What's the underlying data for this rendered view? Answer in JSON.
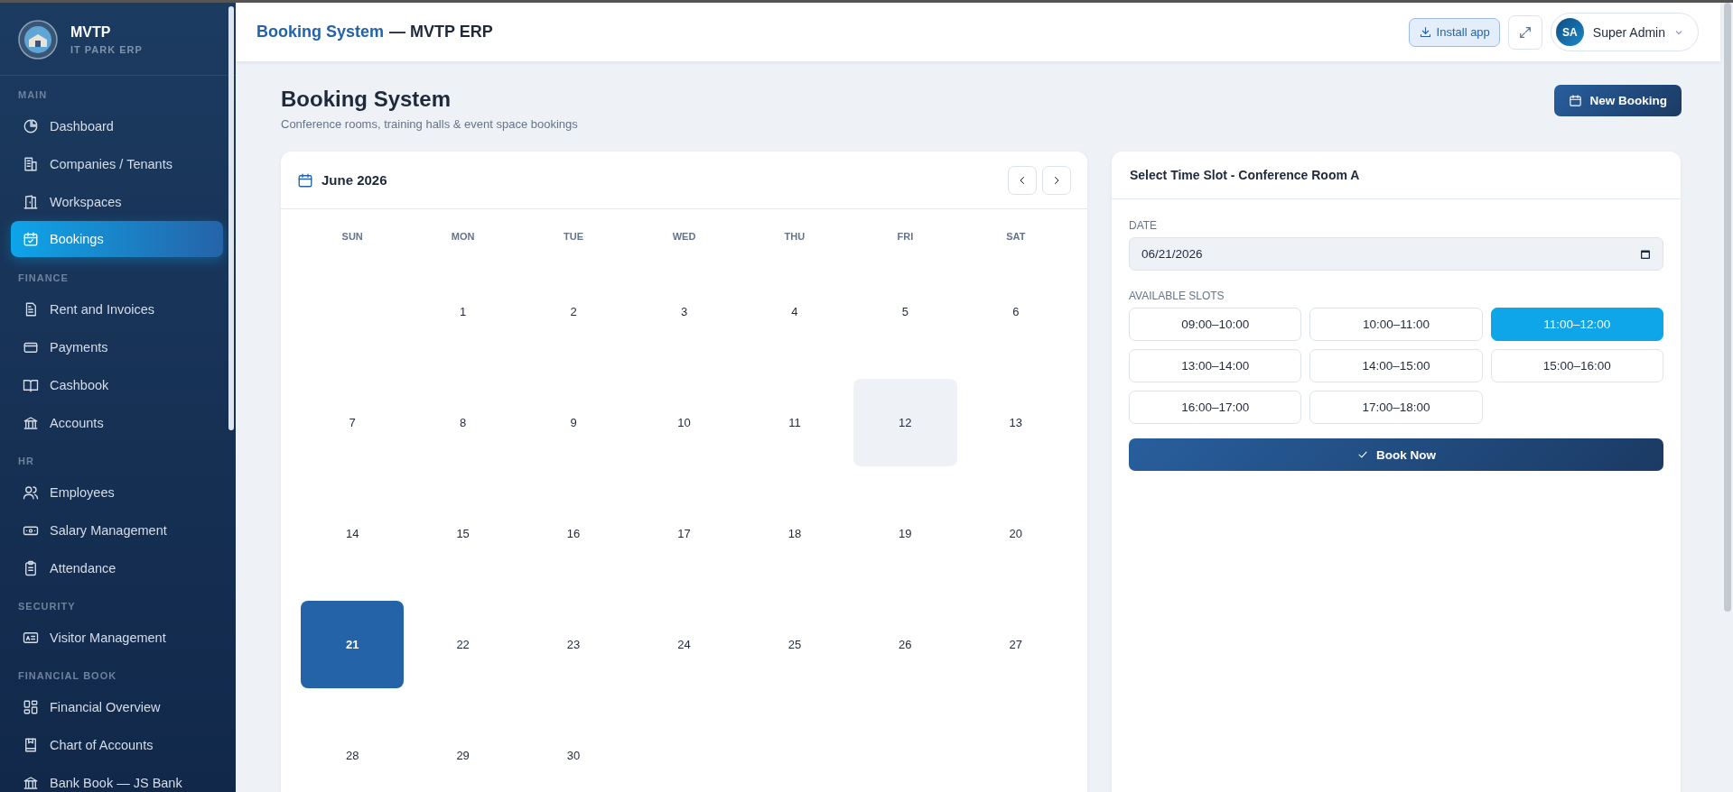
{
  "brand": {
    "name": "MVTP",
    "subtitle": "IT PARK ERP"
  },
  "sidebar": {
    "sections": [
      {
        "title": "MAIN",
        "items": [
          {
            "label": "Dashboard",
            "selected": false
          },
          {
            "label": "Companies / Tenants",
            "selected": false
          },
          {
            "label": "Workspaces",
            "selected": false
          },
          {
            "label": "Bookings",
            "selected": true
          }
        ]
      },
      {
        "title": "FINANCE",
        "items": [
          {
            "label": "Rent and Invoices",
            "selected": false
          },
          {
            "label": "Payments",
            "selected": false
          },
          {
            "label": "Cashbook",
            "selected": false
          },
          {
            "label": "Accounts",
            "selected": false
          }
        ]
      },
      {
        "title": "HR",
        "items": [
          {
            "label": "Employees",
            "selected": false
          },
          {
            "label": "Salary Management",
            "selected": false
          },
          {
            "label": "Attendance",
            "selected": false
          }
        ]
      },
      {
        "title": "SECURITY",
        "items": [
          {
            "label": "Visitor Management",
            "selected": false
          }
        ]
      },
      {
        "title": "FINANCIAL BOOK",
        "items": [
          {
            "label": "Financial Overview",
            "selected": false
          },
          {
            "label": "Chart of Accounts",
            "selected": false
          },
          {
            "label": "Bank Book — JS Bank",
            "selected": false
          }
        ]
      }
    ]
  },
  "header": {
    "title": "Booking System",
    "title_suffix": "— MVTP ERP",
    "install_button": "Install app",
    "user": {
      "initials": "SA",
      "name": "Super Admin"
    }
  },
  "page": {
    "title": "Booking System",
    "subtitle": "Conference rooms, training halls & event space bookings",
    "new_button": "New Booking"
  },
  "calendar": {
    "month": "June 2026",
    "weekdays": [
      "SUN",
      "MON",
      "TUE",
      "WED",
      "THU",
      "FRI",
      "SAT"
    ],
    "weeks": [
      [
        {
          "kind": "blank"
        },
        {
          "kind": "day",
          "label": "1",
          "selected": false,
          "today": false
        },
        {
          "label": "2",
          "selected": false,
          "today": false
        },
        {
          "label": "3",
          "selected": false,
          "today": false
        },
        {
          "label": "4",
          "selected": false,
          "today": false
        },
        {
          "label": "5",
          "selected": false,
          "today": false
        },
        {
          "label": "6",
          "selected": false,
          "today": false
        }
      ],
      [
        {
          "label": "7",
          "selected": false,
          "today": false
        },
        {
          "label": "8",
          "selected": false,
          "today": false
        },
        {
          "label": "9",
          "selected": false,
          "today": false
        },
        {
          "label": "10",
          "selected": false,
          "today": false
        },
        {
          "label": "11",
          "selected": false,
          "today": false
        },
        {
          "label": "12",
          "selected": false,
          "today": true
        },
        {
          "label": "13",
          "selected": false,
          "today": false
        }
      ],
      [
        {
          "label": "14",
          "selected": false,
          "today": false
        },
        {
          "label": "15",
          "selected": false,
          "today": false
        },
        {
          "label": "16",
          "selected": false,
          "today": false
        },
        {
          "label": "17",
          "selected": false,
          "today": false
        },
        {
          "label": "18",
          "selected": false,
          "today": false
        },
        {
          "label": "19",
          "selected": false,
          "today": false
        },
        {
          "label": "20",
          "selected": false,
          "today": false
        }
      ],
      [
        {
          "label": "21",
          "selected": true,
          "today": false
        },
        {
          "label": "22",
          "selected": false,
          "today": false
        },
        {
          "label": "23",
          "selected": false,
          "today": false
        },
        {
          "label": "24",
          "selected": false,
          "today": false
        },
        {
          "label": "25",
          "selected": false,
          "today": false
        },
        {
          "label": "26",
          "selected": false,
          "today": false
        },
        {
          "label": "27",
          "selected": false,
          "today": false
        }
      ],
      [
        {
          "label": "28",
          "selected": false,
          "today": false
        },
        {
          "label": "29",
          "selected": false,
          "today": false
        },
        {
          "label": "30",
          "selected": false,
          "today": false
        }
      ]
    ]
  },
  "slot_panel": {
    "title": "Select Time Slot - Conference Room A",
    "date_label": "DATE",
    "date_value": "06/21/2026",
    "slots_label": "AVAILABLE SLOTS",
    "slots": [
      {
        "label": "09:00–10:00",
        "selected": false
      },
      {
        "label": "10:00–11:00",
        "selected": false
      },
      {
        "label": "11:00–12:00",
        "selected": true
      },
      {
        "label": "13:00–14:00",
        "selected": false
      },
      {
        "label": "14:00–15:00",
        "selected": false
      },
      {
        "label": "15:00–16:00",
        "selected": false
      },
      {
        "label": "16:00–17:00",
        "selected": false
      },
      {
        "label": "17:00–18:00",
        "selected": false
      }
    ],
    "book_button": "Book Now"
  }
}
